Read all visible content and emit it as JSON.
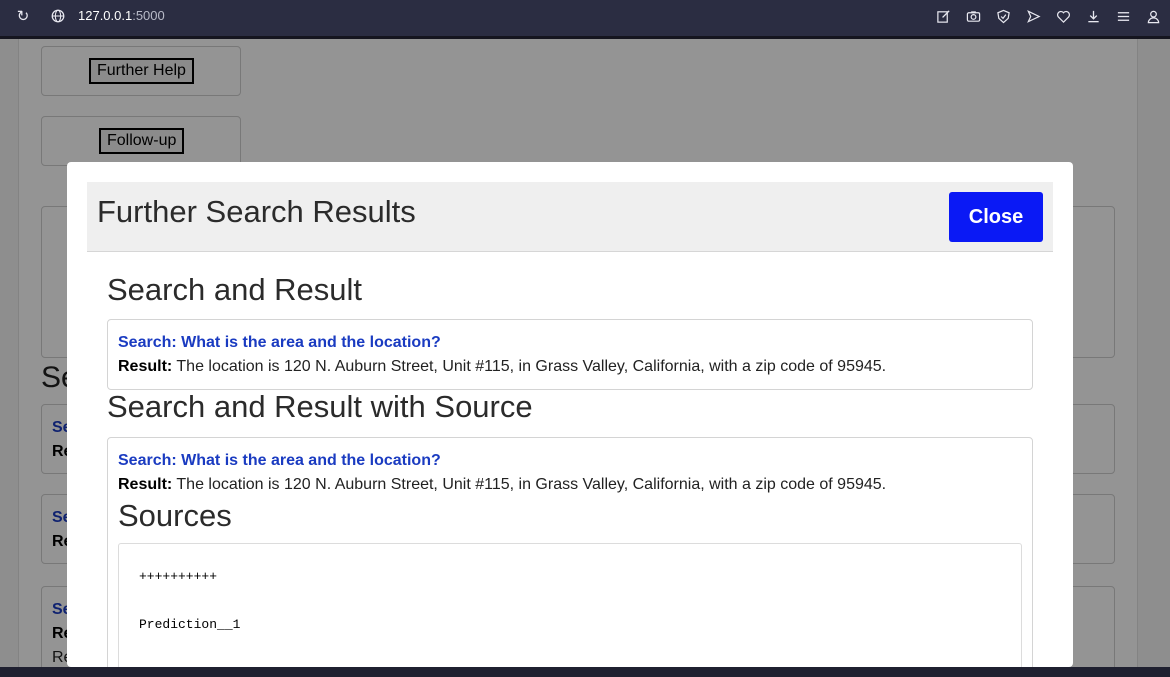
{
  "browser": {
    "url_host": "127.0.0.1",
    "url_port": ":5000",
    "icons": [
      "reload-icon",
      "globe-icon",
      "edit-icon",
      "camera-icon",
      "shield-icon",
      "send-icon",
      "heart-icon",
      "download-icon",
      "menu-icon",
      "profile-icon"
    ]
  },
  "background": {
    "further_help_label": "Further Help",
    "follow_up_label": "Follow-up",
    "heading_fragment": "Se",
    "row_search_fragment": "Se",
    "row_result_fragment": "Re",
    "row_result_fragment2": "Re"
  },
  "modal": {
    "title": "Further Search Results",
    "close_label": "Close",
    "section1_heading": "Search and Result",
    "section1": {
      "search_label": "Search:",
      "search_text": "What is the area and the location?",
      "result_label": "Result:",
      "result_text": "The location is 120 N. Auburn Street, Unit #115, in Grass Valley, California, with a zip code of 95945."
    },
    "section2_heading": "Search and Result with Source",
    "section2": {
      "search_label": "Search:",
      "search_text": "What is the area and the location?",
      "result_label": "Result:",
      "result_text": "The location is 120 N. Auburn Street, Unit #115, in Grass Valley, California, with a zip code of 95945.",
      "sources_heading": "Sources",
      "sources_lines": [
        "++++++++++",
        "Prediction__1"
      ]
    }
  },
  "colors": {
    "close_button": "#0a19f5",
    "search_text": "#1a3bc1",
    "browser_bar": "#2b2d42"
  }
}
